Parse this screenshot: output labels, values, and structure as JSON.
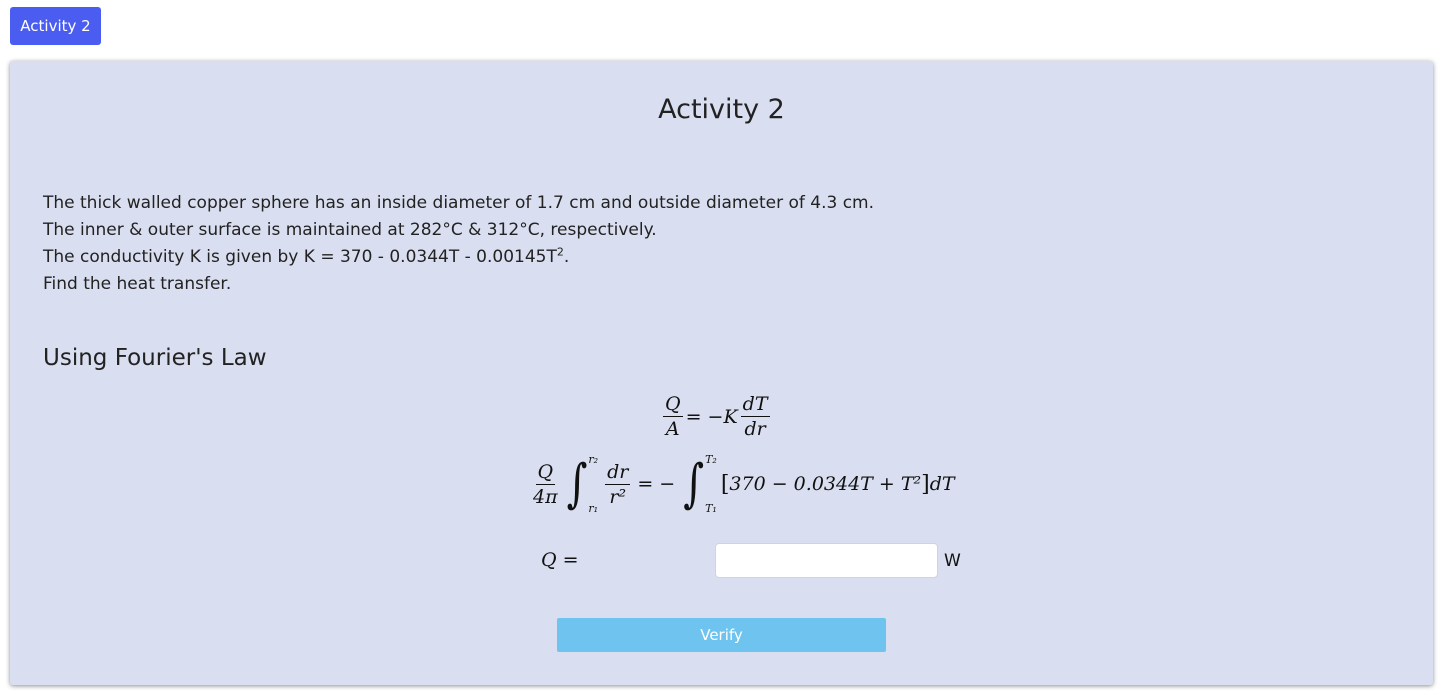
{
  "tab": {
    "label": "Activity 2"
  },
  "card": {
    "title": "Activity 2",
    "problem": {
      "line1": "The thick walled copper sphere has an inside diameter of 1.7 cm and outside diameter of 4.3 cm.",
      "line2": "The inner & outer surface is maintained at 282°C & 312°C, respectively.",
      "line3_prefix": "The conductivity K is given by K = 370 - 0.0344T - 0.00145T",
      "line3_exponent": "2",
      "line3_suffix": ".",
      "line4": "Find the heat transfer."
    },
    "section_title": "Using Fourier's Law",
    "equation1": {
      "lhs_num": "Q",
      "lhs_den": "A",
      "rhs_prefix": "= −K",
      "rhs_num": "dT",
      "rhs_den": "dr"
    },
    "equation2": {
      "lhs_num": "Q",
      "lhs_den": "4π",
      "int1_upper": "r₂",
      "int1_lower": "r₁",
      "int1_num": "dr",
      "int1_den": "r²",
      "equals": "= −",
      "int2_upper": "T₂",
      "int2_lower": "T₁",
      "integrand_open": "[",
      "integrand": "370 − 0.0344T + T²",
      "integrand_close": "]",
      "differential": "dT"
    },
    "answer": {
      "label": "Q =",
      "value": "",
      "placeholder": "",
      "unit": "W"
    },
    "verify_label": "Verify"
  },
  "colors": {
    "tab_bg": "#4a5df0",
    "card_bg": "#d9dff0",
    "verify_bg": "#6ec4ee"
  }
}
